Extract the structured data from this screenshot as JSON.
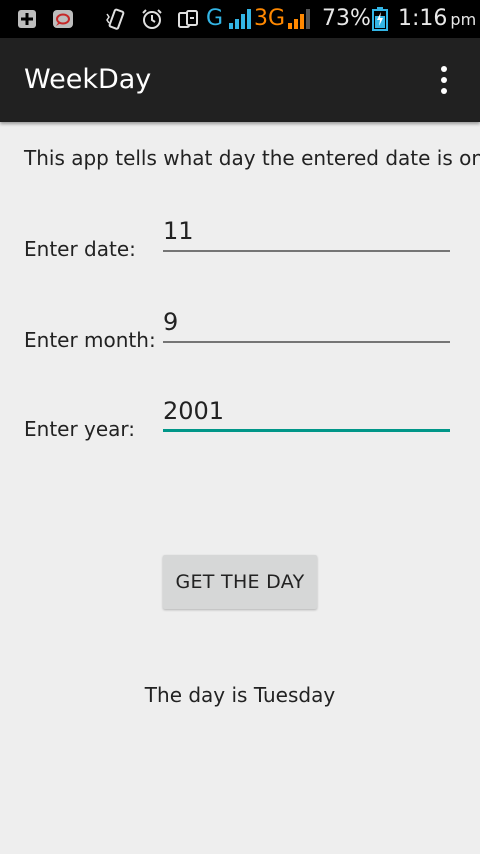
{
  "status_bar": {
    "icons": [
      "add-notification-icon",
      "chat-notification-icon",
      "vibrate-icon",
      "alarm-icon",
      "data-transfer-icon",
      "signal-icon",
      "signal-icon",
      "battery-icon"
    ],
    "network_g": "G",
    "network_3g": "3G",
    "battery_percent": "73%",
    "time": "1:16",
    "time_suffix": "pm",
    "colors": {
      "g_network": "#33b5e5",
      "3g_network": "#ff8800",
      "battery": "#33b5e5"
    }
  },
  "app_bar": {
    "title": "WeekDay",
    "menu_icon": "overflow-menu-icon"
  },
  "main": {
    "intro": "This app tells what day the entered date is on",
    "fields": [
      {
        "label": "Enter date:",
        "value": "11"
      },
      {
        "label": "Enter month:",
        "value": "9"
      },
      {
        "label": "Enter year:",
        "value": "2001"
      }
    ],
    "button_label": "GET THE DAY",
    "result": "The day is Tuesday"
  },
  "colors": {
    "background": "#eeeeee",
    "app_bar": "#212121",
    "accent": "#009688",
    "button": "#d6d7d7"
  }
}
